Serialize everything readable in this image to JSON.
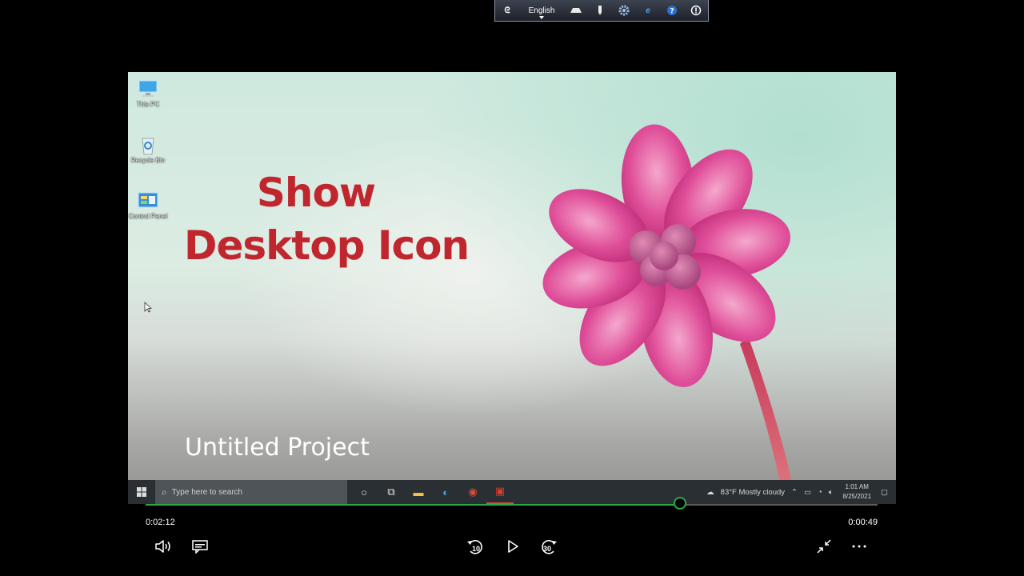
{
  "language_bar": {
    "language": "English",
    "icons": [
      "app-logo-icon",
      "keyboard-icon",
      "pen-icon",
      "settings-gear-icon",
      "internet-explorer-icon",
      "help-icon",
      "info-icon"
    ]
  },
  "desktop": {
    "icons": [
      {
        "label": "This PC",
        "icon": "computer-icon"
      },
      {
        "label": "Recycle Bin",
        "icon": "recycle-bin-icon"
      },
      {
        "label": "Control Panel",
        "icon": "control-panel-icon"
      }
    ]
  },
  "overlay": {
    "title_line1": "Show",
    "title_line2": "Desktop Icon",
    "subtitle": "Untitled Project",
    "title_color": "#c0262e"
  },
  "taskbar": {
    "search_placeholder": "Type here to search",
    "weather": "83°F  Mostly cloudy",
    "time": "1:01 AM",
    "date": "8/25/2021"
  },
  "player": {
    "elapsed": "0:02:12",
    "remaining": "0:00:49",
    "progress_fraction": 0.73,
    "accent_color": "#2ca846",
    "rewind_seconds": "10",
    "forward_seconds": "30"
  }
}
